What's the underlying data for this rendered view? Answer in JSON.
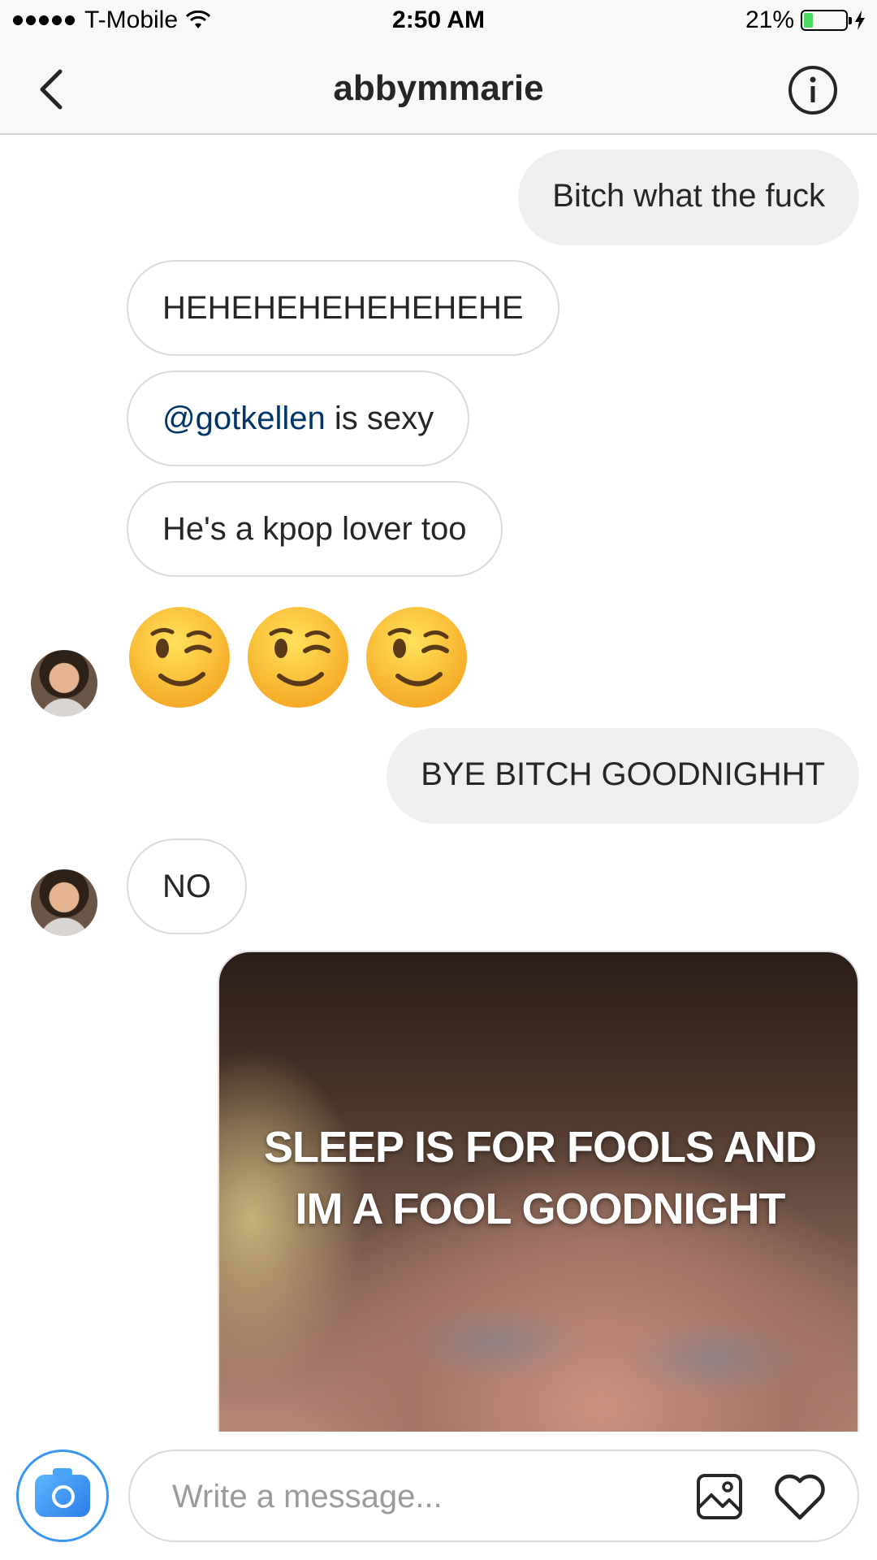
{
  "status_bar": {
    "carrier": "T-Mobile",
    "time": "2:50 AM",
    "battery_percent_label": "21%",
    "battery_level": 0.21
  },
  "nav": {
    "title": "abbymmarie",
    "back_icon": "chevron-left-icon",
    "info_icon": "info-icon"
  },
  "messages": [
    {
      "direction": "sent",
      "text": "Bitch what the fuck"
    },
    {
      "direction": "received",
      "text": "HEHEHEHEHEHEHEHE"
    },
    {
      "direction": "received",
      "mention": "@gotkellen",
      "text": " is sexy"
    },
    {
      "direction": "received",
      "text": "He's a kpop lover too"
    },
    {
      "direction": "received",
      "emoji": [
        "😉",
        "😉",
        "😉"
      ]
    },
    {
      "direction": "sent",
      "text": "BYE BITCH GOODNIGHHT"
    },
    {
      "direction": "received",
      "text": "NO"
    },
    {
      "direction": "sent",
      "type": "image",
      "caption_line1": "SLEEP IS FOR FOOLS AND",
      "caption_line2": "IM A FOOL GOODNIGHT"
    }
  ],
  "composer": {
    "placeholder": "Write a message...",
    "camera_icon": "camera-icon",
    "gallery_icon": "gallery-icon",
    "like_icon": "heart-icon"
  },
  "colors": {
    "mention": "#003569",
    "sent_bubble": "#efefef",
    "received_border": "#dbdbdb",
    "accent": "#3897f0",
    "battery": "#4cd964"
  }
}
